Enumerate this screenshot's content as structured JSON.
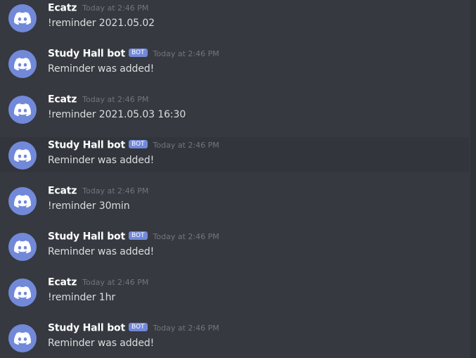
{
  "messages": [
    {
      "author": "Ecatz",
      "bot": false,
      "timestamp": "Today at 2:46 PM",
      "text": "!reminder 2021.05.02"
    },
    {
      "author": "Study Hall bot",
      "bot": true,
      "badge": "BOT",
      "timestamp": "Today at 2:46 PM",
      "text": "Reminder was added!"
    },
    {
      "author": "Ecatz",
      "bot": false,
      "timestamp": "Today at 2:46 PM",
      "text": "!reminder 2021.05.03 16:30"
    },
    {
      "author": "Study Hall bot",
      "bot": true,
      "badge": "BOT",
      "timestamp": "Today at 2:46 PM",
      "text": "Reminder was added!"
    },
    {
      "author": "Ecatz",
      "bot": false,
      "timestamp": "Today at 2:46 PM",
      "text": "!reminder 30min"
    },
    {
      "author": "Study Hall bot",
      "bot": true,
      "badge": "BOT",
      "timestamp": "Today at 2:46 PM",
      "text": "Reminder was added!"
    },
    {
      "author": "Ecatz",
      "bot": false,
      "timestamp": "Today at 2:46 PM",
      "text": "!reminder 1hr"
    },
    {
      "author": "Study Hall bot",
      "bot": true,
      "badge": "BOT",
      "timestamp": "Today at 2:46 PM",
      "text": "Reminder was added!"
    }
  ],
  "icons": {
    "avatar": "discord-logo-icon"
  },
  "colors": {
    "background": "#36393f",
    "avatar": "#7289da",
    "bot_badge": "#7289da",
    "timestamp": "#72767d"
  }
}
